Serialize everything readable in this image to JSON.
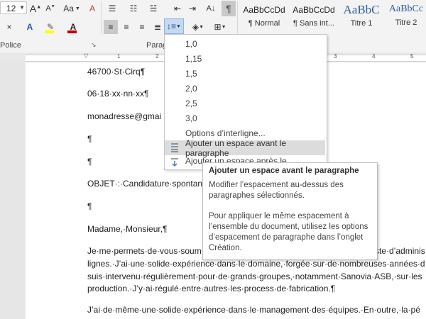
{
  "ribbon": {
    "font_size_value": "12",
    "group_police": "Police",
    "group_paragraphe": "Paragra",
    "aa_label": "Aa",
    "pilcrow": "¶",
    "sort_label": "A↓",
    "styles": [
      {
        "sample": "AaBbCcDd",
        "name": "¶ Normal"
      },
      {
        "sample": "AaBbCcDd",
        "name": "¶ Sans int..."
      },
      {
        "sample": "AaBbC",
        "name": "Titre 1"
      },
      {
        "sample": "AaBbCc",
        "name": "Titre 2"
      }
    ]
  },
  "ruler": {
    "ticks": [
      "1",
      "2",
      "3",
      "4",
      "5"
    ]
  },
  "document": {
    "lines": [
      "46700·St·Cirq¶",
      "06·18·xx·nn·xx¶",
      "monadresse@gmai",
      "¶",
      "¶",
      "OBJET·:·Candidature·spontan",
      "¶",
      "Madame,·Monsieur,¶",
      "Je·me·permets·de·vous·soum",
      "lignes.·J’ai·une·solide·expérience·dans·le·domaine,·forgée·sur·de·nombreuses·années·d",
      "suis·intervenu·régulièrement·pour·de·grands·groupes,·notamment·Sanovia·ASB,·sur·les",
      "production.·J’y·ai·régulé·entre·autres·les·process·de·fabrication.¶",
      "J’ai·de·même·une·solide·expérience·dans·le·management·des·équipes.·En·outre,·la·pé"
    ],
    "line1_tail": "ste·d’adminis"
  },
  "line_spacing_menu": {
    "items": [
      "1,0",
      "1,15",
      "1,5",
      "2,0",
      "2,5",
      "3,0"
    ],
    "options": "Options d’interligne...",
    "add_before": "Ajouter un espace avant le paragraphe",
    "add_after": "Ajouter un espace après le paragraphe"
  },
  "tooltip": {
    "title": "Ajouter un espace avant le paragraphe",
    "desc_lines": [
      "Modifier l’espacement au-dessus des",
      "paragraphes sélectionnés."
    ],
    "body_lines": [
      "Pour appliquer le même espacement à",
      "l’ensemble du document, utilisez les options",
      "d’espacement de paragraphe dans l’onglet",
      "Création."
    ]
  },
  "colors": {
    "accent": "#2b579a",
    "highlight": "#ffff00",
    "font_color": "#c00000",
    "menu_hover": "#dcdcdc"
  }
}
